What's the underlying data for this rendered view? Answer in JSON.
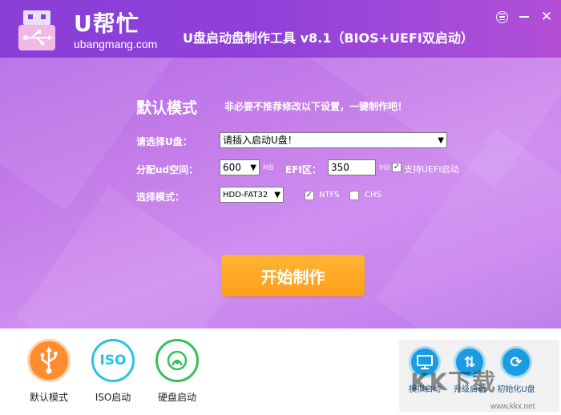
{
  "header": {
    "logo_text": "U帮忙",
    "logo_sub": "ubangmang.com",
    "app_title": "U盘启动盘制作工具 v8.1（BIOS+UEFI双启动）"
  },
  "section": {
    "title": "默认模式",
    "note": "非必要不推荐修改以下设置，一键制作吧！"
  },
  "form": {
    "drive_label": "请选择U盘：",
    "drive_value": "请插入启动U盘！",
    "partition_label": "分配ud空间：",
    "partition_value": "600",
    "partition_unit": "MB",
    "efi_label": "EFI区：",
    "efi_value": "350",
    "efi_unit": "MB",
    "uefi_label": "支持UEFI启动",
    "uefi_checked": true,
    "mode_label": "选择模式：",
    "mode_value": "HDD-FAT32",
    "ntfs_label": "NTFS",
    "ntfs_checked": true,
    "chs_label": "CHS",
    "chs_checked": false
  },
  "start_button": "开始制作",
  "modes": [
    {
      "label": "默认模式",
      "icon": "usb-icon"
    },
    {
      "label": "ISO启动",
      "icon": "iso-icon"
    },
    {
      "label": "硬盘启动",
      "icon": "disk-icon"
    }
  ],
  "tools": [
    {
      "label": "模拟启动",
      "icon": "monitor-icon"
    },
    {
      "label": "升级启动",
      "icon": "updown-arrows-icon"
    },
    {
      "label": "初始化U盘",
      "icon": "refresh-icon"
    }
  ],
  "watermark": {
    "text": "KK下载",
    "url": "www.kkx.net"
  },
  "colors": {
    "accent_purple": "#9b45d8",
    "start_orange": "#ffa21f",
    "mode_default": "#ff8c2e",
    "mode_iso": "#27c3e6",
    "mode_disk": "#35bf5a",
    "tool_blue": "#1b9be0"
  }
}
